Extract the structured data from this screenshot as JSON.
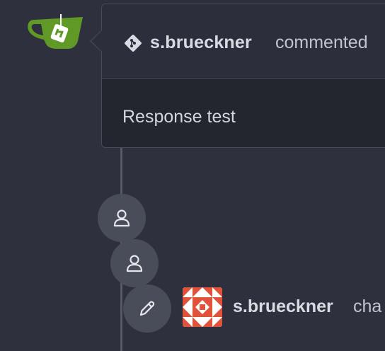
{
  "comment": {
    "author": "s.brueckner",
    "action": "commented",
    "body": "Response test"
  },
  "events": [
    {
      "icon": "person-icon"
    },
    {
      "icon": "person-icon"
    },
    {
      "icon": "pencil-icon",
      "author": "s.brueckner",
      "action": "cha"
    }
  ],
  "colors": {
    "background": "#2e303d",
    "card_header": "#2c2f3b",
    "card_body": "#23262f",
    "gitea_green": "#609926",
    "avatar_red": "#e0533a"
  }
}
